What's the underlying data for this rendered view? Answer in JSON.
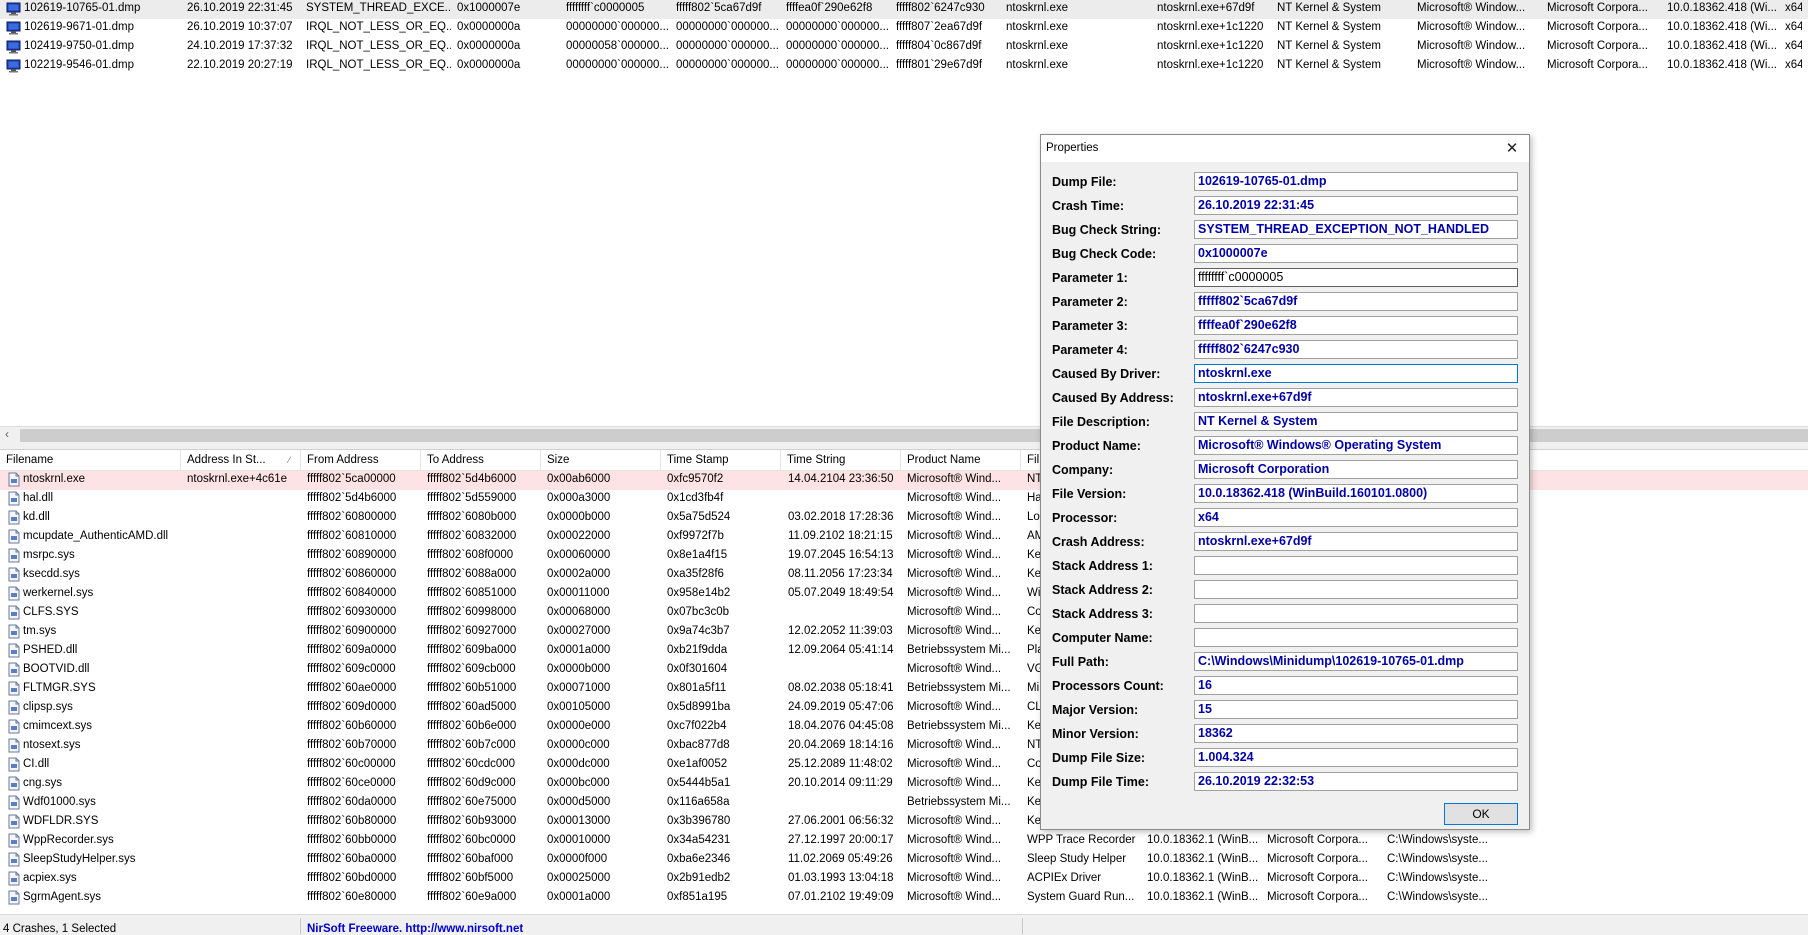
{
  "crash_list": {
    "rows": [
      {
        "filename": "102619-10765-01.dmp",
        "crash_time": "26.10.2019 22:31:45",
        "bug_check_string": "SYSTEM_THREAD_EXCE...",
        "bug_check_code": "0x1000007e",
        "p1": "ffffffff`c0000005",
        "p2": "fffff802`5ca67d9f",
        "p3": "ffffea0f`290e62f8",
        "p4": "fffff802`6247c930",
        "driver": "ntoskrnl.exe",
        "address": "ntoskrnl.exe+67d9f",
        "description": "NT Kernel & System",
        "product": "Microsoft® Window...",
        "company": "Microsoft Corpora...",
        "version": "10.0.18362.418 (Wi...",
        "processor": "x64"
      },
      {
        "filename": "102619-9671-01.dmp",
        "crash_time": "26.10.2019 10:37:07",
        "bug_check_string": "IRQL_NOT_LESS_OR_EQ...",
        "bug_check_code": "0x0000000a",
        "p1": "00000000`000000...",
        "p2": "00000000`000000...",
        "p3": "00000000`000000...",
        "p4": "fffff807`2ea67d9f",
        "driver": "ntoskrnl.exe",
        "address": "ntoskrnl.exe+1c1220",
        "description": "NT Kernel & System",
        "product": "Microsoft® Window...",
        "company": "Microsoft Corpora...",
        "version": "10.0.18362.418 (Wi...",
        "processor": "x64"
      },
      {
        "filename": "102419-9750-01.dmp",
        "crash_time": "24.10.2019 17:37:32",
        "bug_check_string": "IRQL_NOT_LESS_OR_EQ...",
        "bug_check_code": "0x0000000a",
        "p1": "00000058`000000...",
        "p2": "00000000`000000...",
        "p3": "00000000`000000...",
        "p4": "fffff804`0c867d9f",
        "driver": "ntoskrnl.exe",
        "address": "ntoskrnl.exe+1c1220",
        "description": "NT Kernel & System",
        "product": "Microsoft® Window...",
        "company": "Microsoft Corpora...",
        "version": "10.0.18362.418 (Wi...",
        "processor": "x64"
      },
      {
        "filename": "102219-9546-01.dmp",
        "crash_time": "22.10.2019 20:27:19",
        "bug_check_string": "IRQL_NOT_LESS_OR_EQ...",
        "bug_check_code": "0x0000000a",
        "p1": "00000000`000000...",
        "p2": "00000000`000000...",
        "p3": "00000000`000000...",
        "p4": "fffff801`29e67d9f",
        "driver": "ntoskrnl.exe",
        "address": "ntoskrnl.exe+1c1220",
        "description": "NT Kernel & System",
        "product": "Microsoft® Window...",
        "company": "Microsoft Corpora...",
        "version": "10.0.18362.418 (Wi...",
        "processor": "x64"
      }
    ]
  },
  "modules": {
    "headers": [
      "Filename",
      "Address In St...",
      "From Address",
      "To Address",
      "Size",
      "Time Stamp",
      "Time String",
      "Product Name",
      "Fil"
    ],
    "rows": [
      {
        "filename": "ntoskrnl.exe",
        "addr_in_stack": "ntoskrnl.exe+4c61e",
        "from": "fffff802`5ca00000",
        "to": "fffff802`5d4b6000",
        "size": "0x00ab6000",
        "timestamp": "0xfc9570f2",
        "timestring": "14.04.2104 23:36:50",
        "product": "Microsoft® Wind...",
        "file_desc": "NT",
        "file_version": "",
        "company": "",
        "full_path": ""
      },
      {
        "filename": "hal.dll",
        "addr_in_stack": "",
        "from": "fffff802`5d4b6000",
        "to": "fffff802`5d559000",
        "size": "0x000a3000",
        "timestamp": "0x1cd3fb4f",
        "timestring": "",
        "product": "Microsoft® Wind...",
        "file_desc": "Ha",
        "file_version": "",
        "company": "",
        "full_path": ""
      },
      {
        "filename": "kd.dll",
        "addr_in_stack": "",
        "from": "fffff802`60800000",
        "to": "fffff802`6080b000",
        "size": "0x0000b000",
        "timestamp": "0x5a75d524",
        "timestring": "03.02.2018 17:28:36",
        "product": "Microsoft® Wind...",
        "file_desc": "Lo",
        "file_version": "",
        "company": "",
        "full_path": ""
      },
      {
        "filename": "mcupdate_AuthenticAMD.dll",
        "addr_in_stack": "",
        "from": "fffff802`60810000",
        "to": "fffff802`60832000",
        "size": "0x00022000",
        "timestamp": "0xf9972f7b",
        "timestring": "11.09.2102 18:21:15",
        "product": "Microsoft® Wind...",
        "file_desc": "AM",
        "file_version": "",
        "company": "",
        "full_path": ""
      },
      {
        "filename": "msrpc.sys",
        "addr_in_stack": "",
        "from": "fffff802`60890000",
        "to": "fffff802`608f0000",
        "size": "0x00060000",
        "timestamp": "0x8e1a4f15",
        "timestring": "19.07.2045 16:54:13",
        "product": "Microsoft® Wind...",
        "file_desc": "Ke",
        "file_version": "",
        "company": "",
        "full_path": ""
      },
      {
        "filename": "ksecdd.sys",
        "addr_in_stack": "",
        "from": "fffff802`60860000",
        "to": "fffff802`6088a000",
        "size": "0x0002a000",
        "timestamp": "0xa35f28f6",
        "timestring": "08.11.2056 17:23:34",
        "product": "Microsoft® Wind...",
        "file_desc": "Ke",
        "file_version": "",
        "company": "",
        "full_path": ""
      },
      {
        "filename": "werkernel.sys",
        "addr_in_stack": "",
        "from": "fffff802`60840000",
        "to": "fffff802`60851000",
        "size": "0x00011000",
        "timestamp": "0x958e14b2",
        "timestring": "05.07.2049 18:49:54",
        "product": "Microsoft® Wind...",
        "file_desc": "Wi",
        "file_version": "",
        "company": "",
        "full_path": ""
      },
      {
        "filename": "CLFS.SYS",
        "addr_in_stack": "",
        "from": "fffff802`60930000",
        "to": "fffff802`60998000",
        "size": "0x00068000",
        "timestamp": "0x07bc3c0b",
        "timestring": "",
        "product": "Microsoft® Wind...",
        "file_desc": "Co",
        "file_version": "",
        "company": "",
        "full_path": ""
      },
      {
        "filename": "tm.sys",
        "addr_in_stack": "",
        "from": "fffff802`60900000",
        "to": "fffff802`60927000",
        "size": "0x00027000",
        "timestamp": "0x9a74c3b7",
        "timestring": "12.02.2052 11:39:03",
        "product": "Microsoft® Wind...",
        "file_desc": "Ke",
        "file_version": "",
        "company": "",
        "full_path": ""
      },
      {
        "filename": "PSHED.dll",
        "addr_in_stack": "",
        "from": "fffff802`609a0000",
        "to": "fffff802`609ba000",
        "size": "0x0001a000",
        "timestamp": "0xb21f9dda",
        "timestring": "12.09.2064 05:41:14",
        "product": "Betriebssystem Mi...",
        "file_desc": "Pla",
        "file_version": "",
        "company": "",
        "full_path": ""
      },
      {
        "filename": "BOOTVID.dll",
        "addr_in_stack": "",
        "from": "fffff802`609c0000",
        "to": "fffff802`609cb000",
        "size": "0x0000b000",
        "timestamp": "0x0f301604",
        "timestring": "",
        "product": "Microsoft® Wind...",
        "file_desc": "VG",
        "file_version": "",
        "company": "",
        "full_path": ""
      },
      {
        "filename": "FLTMGR.SYS",
        "addr_in_stack": "",
        "from": "fffff802`60ae0000",
        "to": "fffff802`60b51000",
        "size": "0x00071000",
        "timestamp": "0x801a5f11",
        "timestring": "08.02.2038 05:18:41",
        "product": "Betriebssystem Mi...",
        "file_desc": "Mi",
        "file_version": "",
        "company": "",
        "full_path": ""
      },
      {
        "filename": "clipsp.sys",
        "addr_in_stack": "",
        "from": "fffff802`609d0000",
        "to": "fffff802`60ad5000",
        "size": "0x00105000",
        "timestamp": "0x5d8991ba",
        "timestring": "24.09.2019 05:47:06",
        "product": "Microsoft® Wind...",
        "file_desc": "CL",
        "file_version": "",
        "company": "",
        "full_path": ""
      },
      {
        "filename": "cmimcext.sys",
        "addr_in_stack": "",
        "from": "fffff802`60b60000",
        "to": "fffff802`60b6e000",
        "size": "0x0000e000",
        "timestamp": "0xc7f022b4",
        "timestring": "18.04.2076 04:45:08",
        "product": "Betriebssystem Mi...",
        "file_desc": "Ke",
        "file_version": "",
        "company": "",
        "full_path": ""
      },
      {
        "filename": "ntosext.sys",
        "addr_in_stack": "",
        "from": "fffff802`60b70000",
        "to": "fffff802`60b7c000",
        "size": "0x0000c000",
        "timestamp": "0xbac877d8",
        "timestring": "20.04.2069 18:14:16",
        "product": "Microsoft® Wind...",
        "file_desc": "NT",
        "file_version": "",
        "company": "",
        "full_path": ""
      },
      {
        "filename": "CI.dll",
        "addr_in_stack": "",
        "from": "fffff802`60c00000",
        "to": "fffff802`60cdc000",
        "size": "0x000dc000",
        "timestamp": "0xe1af0052",
        "timestring": "25.12.2089 11:48:02",
        "product": "Microsoft® Wind...",
        "file_desc": "Co",
        "file_version": "",
        "company": "",
        "full_path": ""
      },
      {
        "filename": "cng.sys",
        "addr_in_stack": "",
        "from": "fffff802`60ce0000",
        "to": "fffff802`60d9c000",
        "size": "0x000bc000",
        "timestamp": "0x5444b5a1",
        "timestring": "20.10.2014 09:11:29",
        "product": "Microsoft® Wind...",
        "file_desc": "Ke",
        "file_version": "",
        "company": "",
        "full_path": ""
      },
      {
        "filename": "Wdf01000.sys",
        "addr_in_stack": "",
        "from": "fffff802`60da0000",
        "to": "fffff802`60e75000",
        "size": "0x000d5000",
        "timestamp": "0x116a658a",
        "timestring": "",
        "product": "Betriebssystem Mi...",
        "file_desc": "Ke",
        "file_version": "",
        "company": "",
        "full_path": ""
      },
      {
        "filename": "WDFLDR.SYS",
        "addr_in_stack": "",
        "from": "fffff802`60b80000",
        "to": "fffff802`60b93000",
        "size": "0x00013000",
        "timestamp": "0x3b396780",
        "timestring": "27.06.2001 06:56:32",
        "product": "Microsoft® Wind...",
        "file_desc": "Ke",
        "file_version": "",
        "company": "",
        "full_path": ""
      },
      {
        "filename": "WppRecorder.sys",
        "addr_in_stack": "",
        "from": "fffff802`60bb0000",
        "to": "fffff802`60bc0000",
        "size": "0x00010000",
        "timestamp": "0x34a54231",
        "timestring": "27.12.1997 20:00:17",
        "product": "Microsoft® Wind...",
        "file_desc": "WPP Trace Recorder",
        "file_version": "10.0.18362.1 (WinB...",
        "company": "Microsoft Corpora...",
        "full_path": "C:\\Windows\\syste..."
      },
      {
        "filename": "SleepStudyHelper.sys",
        "addr_in_stack": "",
        "from": "fffff802`60ba0000",
        "to": "fffff802`60baf000",
        "size": "0x0000f000",
        "timestamp": "0xba6e2346",
        "timestring": "11.02.2069 05:49:26",
        "product": "Microsoft® Wind...",
        "file_desc": "Sleep Study Helper",
        "file_version": "10.0.18362.1 (WinB...",
        "company": "Microsoft Corpora...",
        "full_path": "C:\\Windows\\syste..."
      },
      {
        "filename": "acpiex.sys",
        "addr_in_stack": "",
        "from": "fffff802`60bd0000",
        "to": "fffff802`60bf5000",
        "size": "0x00025000",
        "timestamp": "0x2b91edb2",
        "timestring": "01.03.1993 13:04:18",
        "product": "Microsoft® Wind...",
        "file_desc": "ACPIEx Driver",
        "file_version": "10.0.18362.1 (WinB...",
        "company": "Microsoft Corpora...",
        "full_path": "C:\\Windows\\syste..."
      },
      {
        "filename": "SgrmAgent.sys",
        "addr_in_stack": "",
        "from": "fffff802`60e80000",
        "to": "fffff802`60e9a000",
        "size": "0x0001a000",
        "timestamp": "0xf851a195",
        "timestring": "07.01.2102 19:49:09",
        "product": "Microsoft® Wind...",
        "file_desc": "System Guard Run...",
        "file_version": "10.0.18362.1 (WinB...",
        "company": "Microsoft Corpora...",
        "full_path": "C:\\Windows\\syste..."
      }
    ]
  },
  "statusbar": {
    "count": "4 Crashes, 1 Selected",
    "link": "NirSoft Freeware.  http://www.nirsoft.net"
  },
  "properties": {
    "title": "Properties",
    "close_glyph": "✕",
    "ok_label": "OK",
    "fields": [
      {
        "label": "Dump File:",
        "value": "102619-10765-01.dmp"
      },
      {
        "label": "Crash Time:",
        "value": "26.10.2019 22:31:45"
      },
      {
        "label": "Bug Check String:",
        "value": "SYSTEM_THREAD_EXCEPTION_NOT_HANDLED"
      },
      {
        "label": "Bug Check Code:",
        "value": "0x1000007e"
      },
      {
        "label": "Parameter 1:",
        "value": "ffffffff`c0000005"
      },
      {
        "label": "Parameter 2:",
        "value": "fffff802`5ca67d9f"
      },
      {
        "label": "Parameter 3:",
        "value": "ffffea0f`290e62f8"
      },
      {
        "label": "Parameter 4:",
        "value": "fffff802`6247c930"
      },
      {
        "label": "Caused By Driver:",
        "value": "ntoskrnl.exe"
      },
      {
        "label": "Caused By Address:",
        "value": "ntoskrnl.exe+67d9f"
      },
      {
        "label": "File Description:",
        "value": "NT Kernel & System"
      },
      {
        "label": "Product Name:",
        "value": "Microsoft® Windows® Operating System"
      },
      {
        "label": "Company:",
        "value": "Microsoft Corporation"
      },
      {
        "label": "File Version:",
        "value": "10.0.18362.418 (WinBuild.160101.0800)"
      },
      {
        "label": "Processor:",
        "value": "x64"
      },
      {
        "label": "Crash Address:",
        "value": "ntoskrnl.exe+67d9f"
      },
      {
        "label": "Stack Address 1:",
        "value": ""
      },
      {
        "label": "Stack Address 2:",
        "value": ""
      },
      {
        "label": "Stack Address 3:",
        "value": ""
      },
      {
        "label": "Computer Name:",
        "value": ""
      },
      {
        "label": "Full Path:",
        "value": "C:\\Windows\\Minidump\\102619-10765-01.dmp"
      },
      {
        "label": "Processors Count:",
        "value": "16"
      },
      {
        "label": "Major Version:",
        "value": "15"
      },
      {
        "label": "Minor Version:",
        "value": "18362"
      },
      {
        "label": "Dump File Size:",
        "value": "1.004.324"
      },
      {
        "label": "Dump File Time:",
        "value": "26.10.2019 22:32:53"
      }
    ]
  },
  "colors": {
    "selected_crash_row": "#ececec",
    "selected_module_row": "#fde3e3",
    "value_text": "#0000a8",
    "link_text": "#0000cc",
    "focus_border": "#0078d7"
  },
  "icons": {
    "dump_file": "dump-file-icon",
    "module_file": "module-file-icon",
    "close": "close-icon",
    "scroll_left": "scroll-left-arrow-icon",
    "sort": "sort-indicator-icon"
  }
}
